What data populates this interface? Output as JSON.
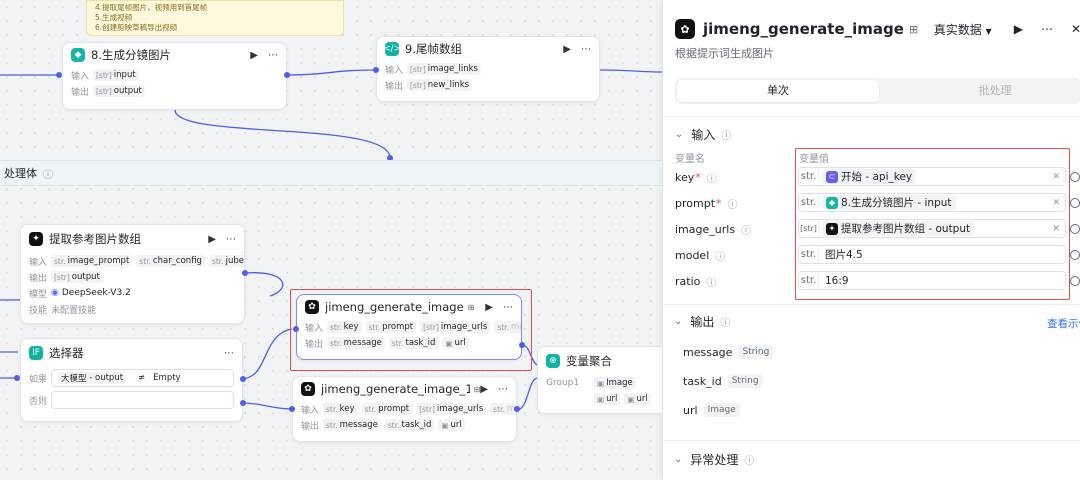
{
  "note": {
    "lines": [
      "4.提取尾帧图片，视频用到首尾帧",
      "5.生成视频",
      "6.创建剪映草稿导出视频"
    ]
  },
  "band": {
    "title": "处理体",
    "info_icon": "info-icon"
  },
  "nodes": {
    "storyboard": {
      "title": "8.生成分镜图片",
      "input_label": "输入",
      "input": "input",
      "output_label": "输出",
      "output": "output"
    },
    "tail_frames": {
      "title": "9.尾帧数组",
      "input_label": "输入",
      "input": "image_links",
      "output_label": "输出",
      "output": "new_links"
    },
    "extract_refs": {
      "title": "提取参考图片数组",
      "input_label": "输入",
      "inputs": [
        "image_prompt",
        "char_config",
        "juben"
      ],
      "output_label": "输出",
      "output": "output",
      "model_label": "模型",
      "model": "DeepSeek-V3.2",
      "skill_label": "技能",
      "skill": "未配置技能"
    },
    "selector": {
      "title": "选择器",
      "if_label": "如果",
      "cond_left_a": "大模型",
      "cond_sep": "-",
      "cond_left_b": "output",
      "cond_op": "≠",
      "cond_right": "Empty",
      "else_label": "否则"
    },
    "jimeng1": {
      "title": "jimeng_generate_image",
      "input_label": "输入",
      "inputs": [
        "key",
        "prompt",
        "image_urls",
        "mo..."
      ],
      "output_label": "输出",
      "outputs": [
        "message",
        "task_id",
        "url"
      ]
    },
    "jimeng2": {
      "title": "jimeng_generate_image_1",
      "input_label": "输入",
      "inputs": [
        "key",
        "prompt",
        "image_urls",
        "mo..."
      ],
      "output_label": "输出",
      "outputs": [
        "message",
        "task_id",
        "url"
      ]
    },
    "aggregate": {
      "title": "变量聚合",
      "group_label": "Group1",
      "items": [
        "Image",
        "url",
        "url"
      ]
    }
  },
  "panel": {
    "title": "jimeng_generate_image",
    "data_mode": "真实数据",
    "description": "根据提示词生成图片",
    "tabs": [
      "单次",
      "批处理"
    ],
    "input_section": "输入",
    "col_name": "变量名",
    "col_value": "变量值",
    "params": [
      {
        "name": "key",
        "required": "*",
        "type": "str.",
        "ref_node": "开始",
        "ref_sep": "-",
        "ref_var": "api_key"
      },
      {
        "name": "prompt",
        "required": "*",
        "type": "str.",
        "ref_node": "8.生成分镜图片",
        "ref_sep": "-",
        "ref_var": "input"
      },
      {
        "name": "image_urls",
        "required": "",
        "type": "[str]",
        "ref_node": "提取参考图片数组",
        "ref_sep": "-",
        "ref_var": "output"
      },
      {
        "name": "model",
        "required": "",
        "type": "str.",
        "value": "图片4.5"
      },
      {
        "name": "ratio",
        "required": "",
        "type": "str.",
        "value": "16:9"
      }
    ],
    "output_section": "输出",
    "view_example": "查看示例",
    "outputs": [
      {
        "name": "message",
        "type": "String"
      },
      {
        "name": "task_id",
        "type": "String"
      },
      {
        "name": "url",
        "type": "Image"
      }
    ],
    "error_section": "异常处理"
  },
  "colors": {
    "accent": "#4e5ef0",
    "highlight": "#e05050",
    "link": "#3370ff"
  }
}
